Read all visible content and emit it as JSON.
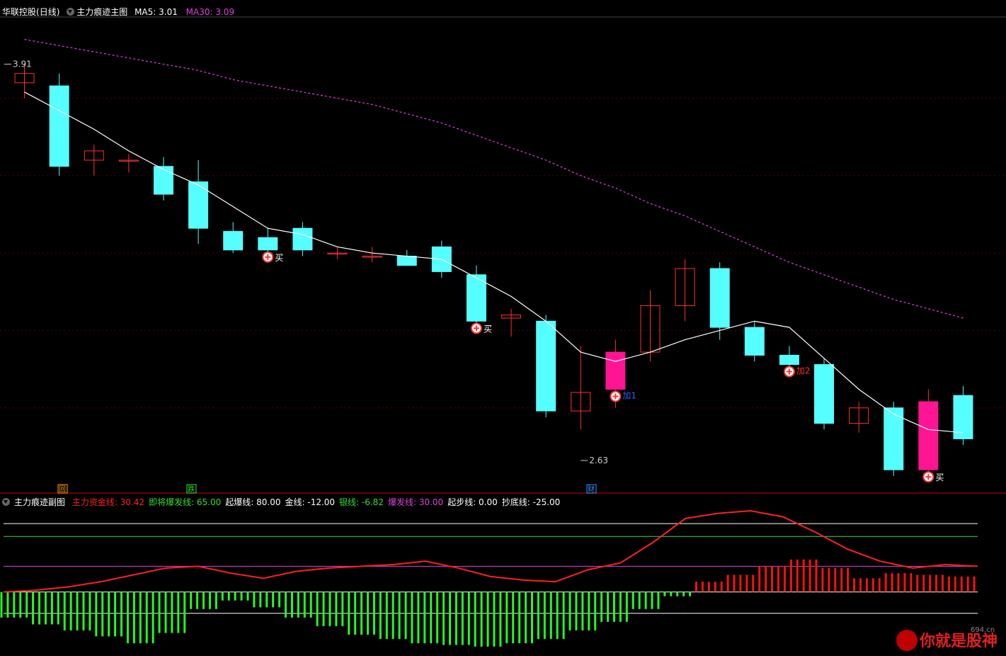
{
  "header": {
    "stock_name": "华联控股",
    "period": "(日线)",
    "main_title": "主力痕迹主图",
    "ma5_label": "MA5: 3.01",
    "ma30_label": "MA30: 3.09",
    "sub_title": "主力痕迹副图",
    "sub_legend": [
      {
        "label": "主力资金线: 30.42",
        "color": "#ff2020"
      },
      {
        "label": "即将爆发线: 65.00",
        "color": "#30e030"
      },
      {
        "label": "起爆线: 80.00",
        "color": "#ffffff"
      },
      {
        "label": "金线: -12.00",
        "color": "#ffffff"
      },
      {
        "label": "银线: -6.82",
        "color": "#30e030"
      },
      {
        "label": "爆发线: 30.00",
        "color": "#e040e0"
      },
      {
        "label": "起步线: 0.00",
        "color": "#ffffff"
      },
      {
        "label": "抄底线: -25.00",
        "color": "#ffffff"
      }
    ]
  },
  "colors": {
    "up": "#ff3030",
    "down": "#55ffff",
    "ma5": "#ffffff",
    "ma30": "#e040e0",
    "signal_bar": "#ff1493",
    "fund_line": "#ff2020",
    "macd_up": "#ff1010",
    "macd_down": "#20ff20"
  },
  "markers": {
    "high_label": "3.91",
    "low_label": "2.63",
    "buy_text": "买",
    "add1_text": "加1",
    "add2_text": "加2",
    "tag_hui": "回",
    "tag_die": "跌",
    "tag_cai": "财"
  },
  "watermark": {
    "text": "你就是股神",
    "site": "694.cn"
  },
  "chart_data": [
    {
      "type": "candlestick",
      "title": "主力痕迹主图",
      "price_range": [
        2.63,
        3.91
      ],
      "candles": [
        [
          3.85,
          3.91,
          3.8,
          3.88
        ],
        [
          3.84,
          3.88,
          3.55,
          3.58
        ],
        [
          3.6,
          3.65,
          3.55,
          3.63
        ],
        [
          3.6,
          3.62,
          3.56,
          3.6
        ],
        [
          3.58,
          3.61,
          3.47,
          3.49
        ],
        [
          3.53,
          3.6,
          3.33,
          3.38
        ],
        [
          3.37,
          3.4,
          3.3,
          3.31
        ],
        [
          3.35,
          3.38,
          3.3,
          3.31
        ],
        [
          3.38,
          3.4,
          3.29,
          3.31
        ],
        [
          3.3,
          3.32,
          3.28,
          3.3
        ],
        [
          3.29,
          3.32,
          3.27,
          3.29
        ],
        [
          3.29,
          3.31,
          3.26,
          3.26
        ],
        [
          3.32,
          3.34,
          3.22,
          3.24
        ],
        [
          3.23,
          3.26,
          3.07,
          3.08
        ],
        [
          3.09,
          3.12,
          3.03,
          3.1
        ],
        [
          3.08,
          3.1,
          2.77,
          2.79
        ],
        [
          2.79,
          3.0,
          2.73,
          2.85
        ],
        [
          2.86,
          3.02,
          2.8,
          2.98
        ],
        [
          2.98,
          3.18,
          2.95,
          3.13
        ],
        [
          3.13,
          3.28,
          3.08,
          3.25
        ],
        [
          3.25,
          3.27,
          3.02,
          3.06
        ],
        [
          3.06,
          3.08,
          2.95,
          2.97
        ],
        [
          2.97,
          3.0,
          2.9,
          2.94
        ],
        [
          2.94,
          2.96,
          2.73,
          2.75
        ],
        [
          2.75,
          2.82,
          2.72,
          2.8
        ],
        [
          2.8,
          2.82,
          2.58,
          2.6
        ],
        [
          2.6,
          2.86,
          2.57,
          2.82
        ],
        [
          2.84,
          2.87,
          2.68,
          2.7
        ]
      ],
      "ma5": [
        3.82,
        3.76,
        3.7,
        3.63,
        3.57,
        3.52,
        3.45,
        3.38,
        3.36,
        3.32,
        3.3,
        3.29,
        3.28,
        3.22,
        3.16,
        3.08,
        2.98,
        2.95,
        2.98,
        3.02,
        3.05,
        3.08,
        3.06,
        2.96,
        2.86,
        2.78,
        2.73,
        2.72
      ],
      "ma30": [
        3.99,
        3.97,
        3.95,
        3.93,
        3.91,
        3.89,
        3.86,
        3.84,
        3.82,
        3.8,
        3.78,
        3.75,
        3.72,
        3.68,
        3.64,
        3.6,
        3.55,
        3.51,
        3.46,
        3.42,
        3.37,
        3.32,
        3.27,
        3.23,
        3.19,
        3.15,
        3.12,
        3.09
      ],
      "signals": [
        {
          "index": 7,
          "kind": "buy",
          "text": "买"
        },
        {
          "index": 13,
          "kind": "buy",
          "text": "买"
        },
        {
          "index": 17,
          "kind": "add",
          "text": "加1"
        },
        {
          "index": 22,
          "kind": "add",
          "text": "加2"
        },
        {
          "index": 26,
          "kind": "buy",
          "text": "买"
        }
      ]
    },
    {
      "type": "line+bar",
      "title": "主力痕迹副图",
      "reference_lines": [
        {
          "name": "起爆线",
          "value": 80
        },
        {
          "name": "即将爆发线",
          "value": 65
        },
        {
          "name": "爆发线",
          "value": 30
        },
        {
          "name": "起步线",
          "value": 0
        },
        {
          "name": "抄底线",
          "value": -25
        }
      ],
      "fund_line": [
        0,
        2,
        6,
        12,
        20,
        28,
        30,
        22,
        16,
        24,
        28,
        30,
        32,
        36,
        28,
        18,
        14,
        12,
        26,
        34,
        58,
        86,
        92,
        95,
        88,
        70,
        50,
        36,
        28,
        32,
        30
      ],
      "histogram": [
        -30,
        -38,
        -45,
        -52,
        -60,
        -48,
        -20,
        -10,
        -18,
        -30,
        -40,
        -50,
        -55,
        -60,
        -62,
        -64,
        -60,
        -55,
        -45,
        -35,
        -20,
        -5,
        12,
        20,
        30,
        38,
        28,
        16,
        22,
        20,
        18
      ]
    }
  ]
}
